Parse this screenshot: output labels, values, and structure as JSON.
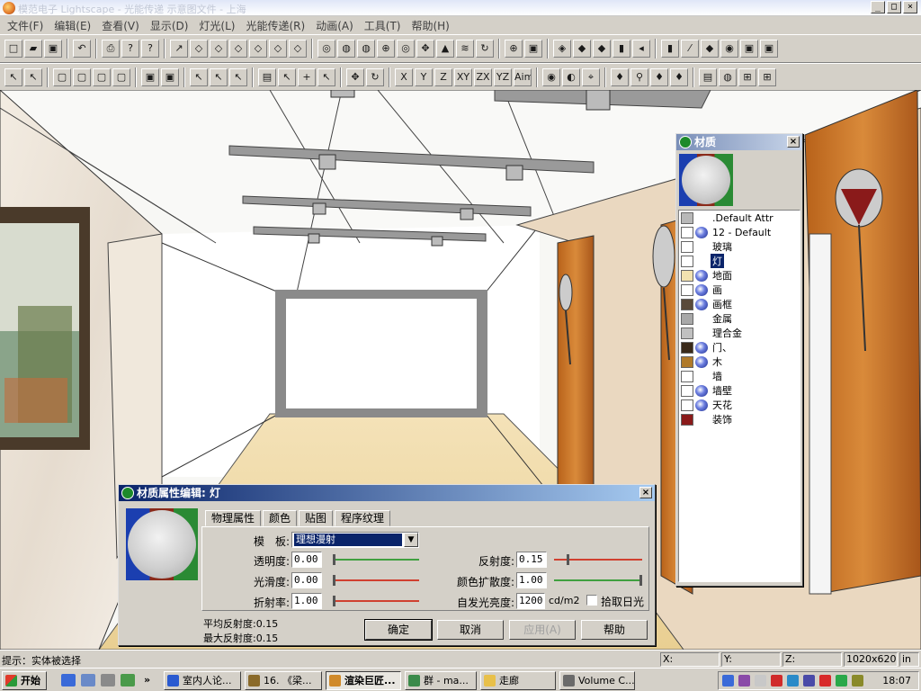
{
  "window": {
    "title": "模范电子 Lightscape - 光能传递 示意图文件 - 上海",
    "min": "_",
    "max": "□",
    "close": "×"
  },
  "menu": [
    "文件(F)",
    "编辑(E)",
    "查看(V)",
    "显示(D)",
    "灯光(L)",
    "光能传递(R)",
    "动画(A)",
    "工具(T)",
    "帮助(H)"
  ],
  "toolbar1": [
    "□",
    "▰",
    "▣",
    "↶",
    "⎙",
    "?",
    "?",
    "↗",
    "◇",
    "◇",
    "◇",
    "◇",
    "◇",
    "◇",
    "◎",
    "◍",
    "◍",
    "⊕",
    "◎",
    "✥",
    "▲",
    "≋",
    "↻",
    "⊕",
    "▣",
    "◈",
    "◆",
    "◆",
    "▮",
    "◂",
    "▮",
    "⁄",
    "◆",
    "◉",
    "▣",
    "▣"
  ],
  "toolbar2": [
    "↖",
    "↖",
    "▢",
    "▢",
    "▢",
    "▢",
    "▣",
    "▣",
    "↖",
    "↖",
    "↖",
    "▤",
    "↖",
    "+",
    "↖",
    "✥",
    "↻",
    "X",
    "Y",
    "Z",
    "XY",
    "ZX",
    "YZ",
    "Aim",
    "◉",
    "◐",
    "⌖",
    "♦",
    "⚲",
    "♦",
    "♦",
    "▤",
    "◍",
    "⊞",
    "⊞"
  ],
  "material_list": {
    "title": "材质",
    "items": [
      {
        "name": ".Default Attr",
        "color": "#b8b8b8",
        "textured": false
      },
      {
        "name": "12 - Default",
        "color": "#ffffff",
        "textured": true
      },
      {
        "name": "玻璃",
        "color": "#ffffff",
        "textured": false
      },
      {
        "name": "灯",
        "color": "#ffffff",
        "textured": false,
        "selected": true
      },
      {
        "name": "地面",
        "color": "#f2e2b0",
        "textured": true
      },
      {
        "name": "画",
        "color": "#ffffff",
        "textured": true
      },
      {
        "name": "画框",
        "color": "#5a4a3a",
        "textured": true
      },
      {
        "name": "金属",
        "color": "#a8a8a8",
        "textured": false
      },
      {
        "name": "理合金",
        "color": "#c0c0c0",
        "textured": false
      },
      {
        "name": "门、",
        "color": "#3a2a1a",
        "textured": true
      },
      {
        "name": "木",
        "color": "#b07a2a",
        "textured": true
      },
      {
        "name": "墙",
        "color": "#ffffff",
        "textured": false
      },
      {
        "name": "墙壁",
        "color": "#ffffff",
        "textured": true
      },
      {
        "name": "天花",
        "color": "#ffffff",
        "textured": true
      },
      {
        "name": "装饰",
        "color": "#8a1a1a",
        "textured": false
      }
    ]
  },
  "material_editor": {
    "title": "材质属性编辑: 灯",
    "tabs": [
      "物理属性",
      "颜色",
      "贴图",
      "程序纹理"
    ],
    "template_label": "模　板:",
    "template_value": "理想漫射",
    "fields": {
      "transparency": {
        "label": "透明度:",
        "value": "0.00",
        "level": 0.0
      },
      "smoothness": {
        "label": "光滑度:",
        "value": "0.00",
        "level": 0.0
      },
      "refraction": {
        "label": "折射率:",
        "value": "1.00",
        "level": 0.0
      },
      "reflectance": {
        "label": "反射度:",
        "value": "0.15",
        "level": 0.15
      },
      "color_bleed": {
        "label": "颜色扩散度:",
        "value": "1.00",
        "level": 1.0
      },
      "luminance": {
        "label": "自发光亮度:",
        "value": "1200",
        "unit": "cd/m2"
      }
    },
    "daylight_label": "拾取日光",
    "avg_reflect": "平均反射度:0.15",
    "max_reflect": "最大反射度:0.15",
    "buttons": {
      "ok": "确定",
      "cancel": "取消",
      "apply": "应用(A)",
      "help": "帮助"
    }
  },
  "status": {
    "message": "提示：实体被选择",
    "x": "X:",
    "y": "Y:",
    "z": "Z:",
    "size": "1020x620",
    "unit": "in"
  },
  "taskbar": {
    "start": "开始",
    "tasks": [
      "室内人论...",
      "16. 《梁...",
      "渲染巨匠...",
      "群 - ma...",
      "走廊",
      "Volume C..."
    ],
    "clock": "18:07"
  }
}
